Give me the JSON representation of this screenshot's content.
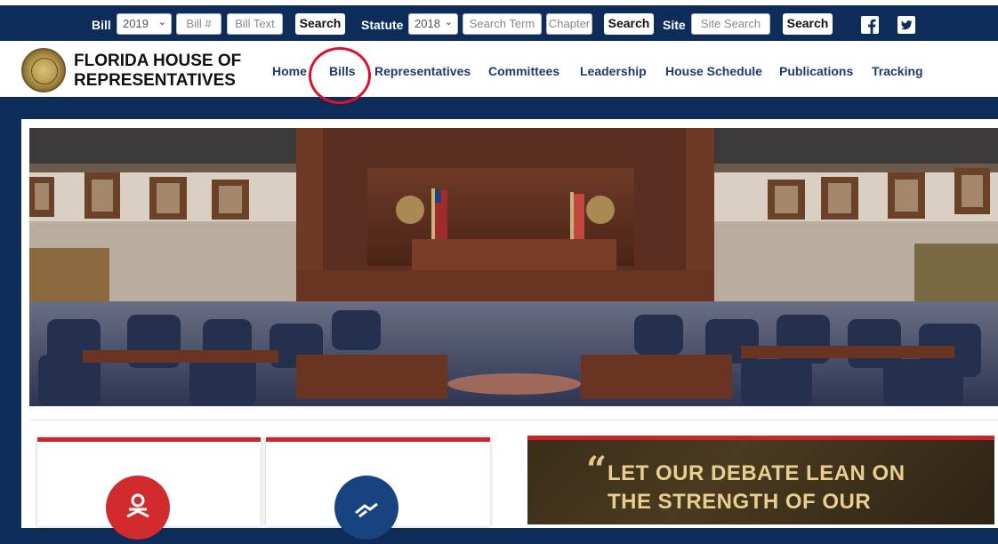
{
  "topbar": {
    "bill_label": "Bill",
    "bill_year": "2019",
    "bill_number_placeholder": "Bill #",
    "bill_text_placeholder": "Bill Text",
    "bill_search": "Search",
    "statute_label": "Statute",
    "statute_year": "2018",
    "search_term_placeholder": "Search Term",
    "chapter_placeholder": "Chapter",
    "statute_search": "Search",
    "site_label": "Site",
    "site_search_placeholder": "Site Search",
    "site_search": "Search"
  },
  "header": {
    "brand_line1": "FLORIDA HOUSE OF",
    "brand_line2": "REPRESENTATIVES"
  },
  "nav": {
    "items": [
      "Home",
      "Bills",
      "Representatives",
      "Committees",
      "Leadership",
      "House Schedule",
      "Publications",
      "Tracking"
    ]
  },
  "quote": {
    "mark": "“",
    "line1": "LET OUR DEBATE LEAN ON",
    "line2": "THE STRENGTH OF OUR"
  },
  "colors": {
    "navy": "#0d2c5a",
    "accent_red": "#c8262c",
    "nav_text": "#1d3b6b",
    "annotation_red": "#e0102a"
  },
  "icons": [
    "chevron-down-icon",
    "facebook-icon",
    "twitter-icon",
    "seal-icon",
    "reader-icon",
    "handshake-icon"
  ]
}
